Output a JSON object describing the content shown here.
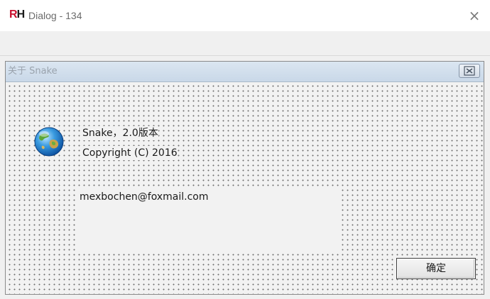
{
  "window": {
    "logo_text": "RH",
    "title": "Dialog - 134",
    "close_glyph": "×"
  },
  "dialog": {
    "title": "关于 Snake",
    "close_glyph": "⊠",
    "icon": "globe-icon",
    "product_line": "Snake，2.0版本",
    "copyright_line": "Copyright (C) 2016",
    "email_line": "mexbochen@foxmail.com",
    "ok_label": "确定"
  },
  "colors": {
    "caption_gradient_top": "#dbe6f1",
    "caption_gradient_bottom": "#c9d8e8",
    "dialog_background": "#f2f2f2",
    "grid_dot": "#6f6f6f",
    "logo_red": "#c8102e"
  }
}
